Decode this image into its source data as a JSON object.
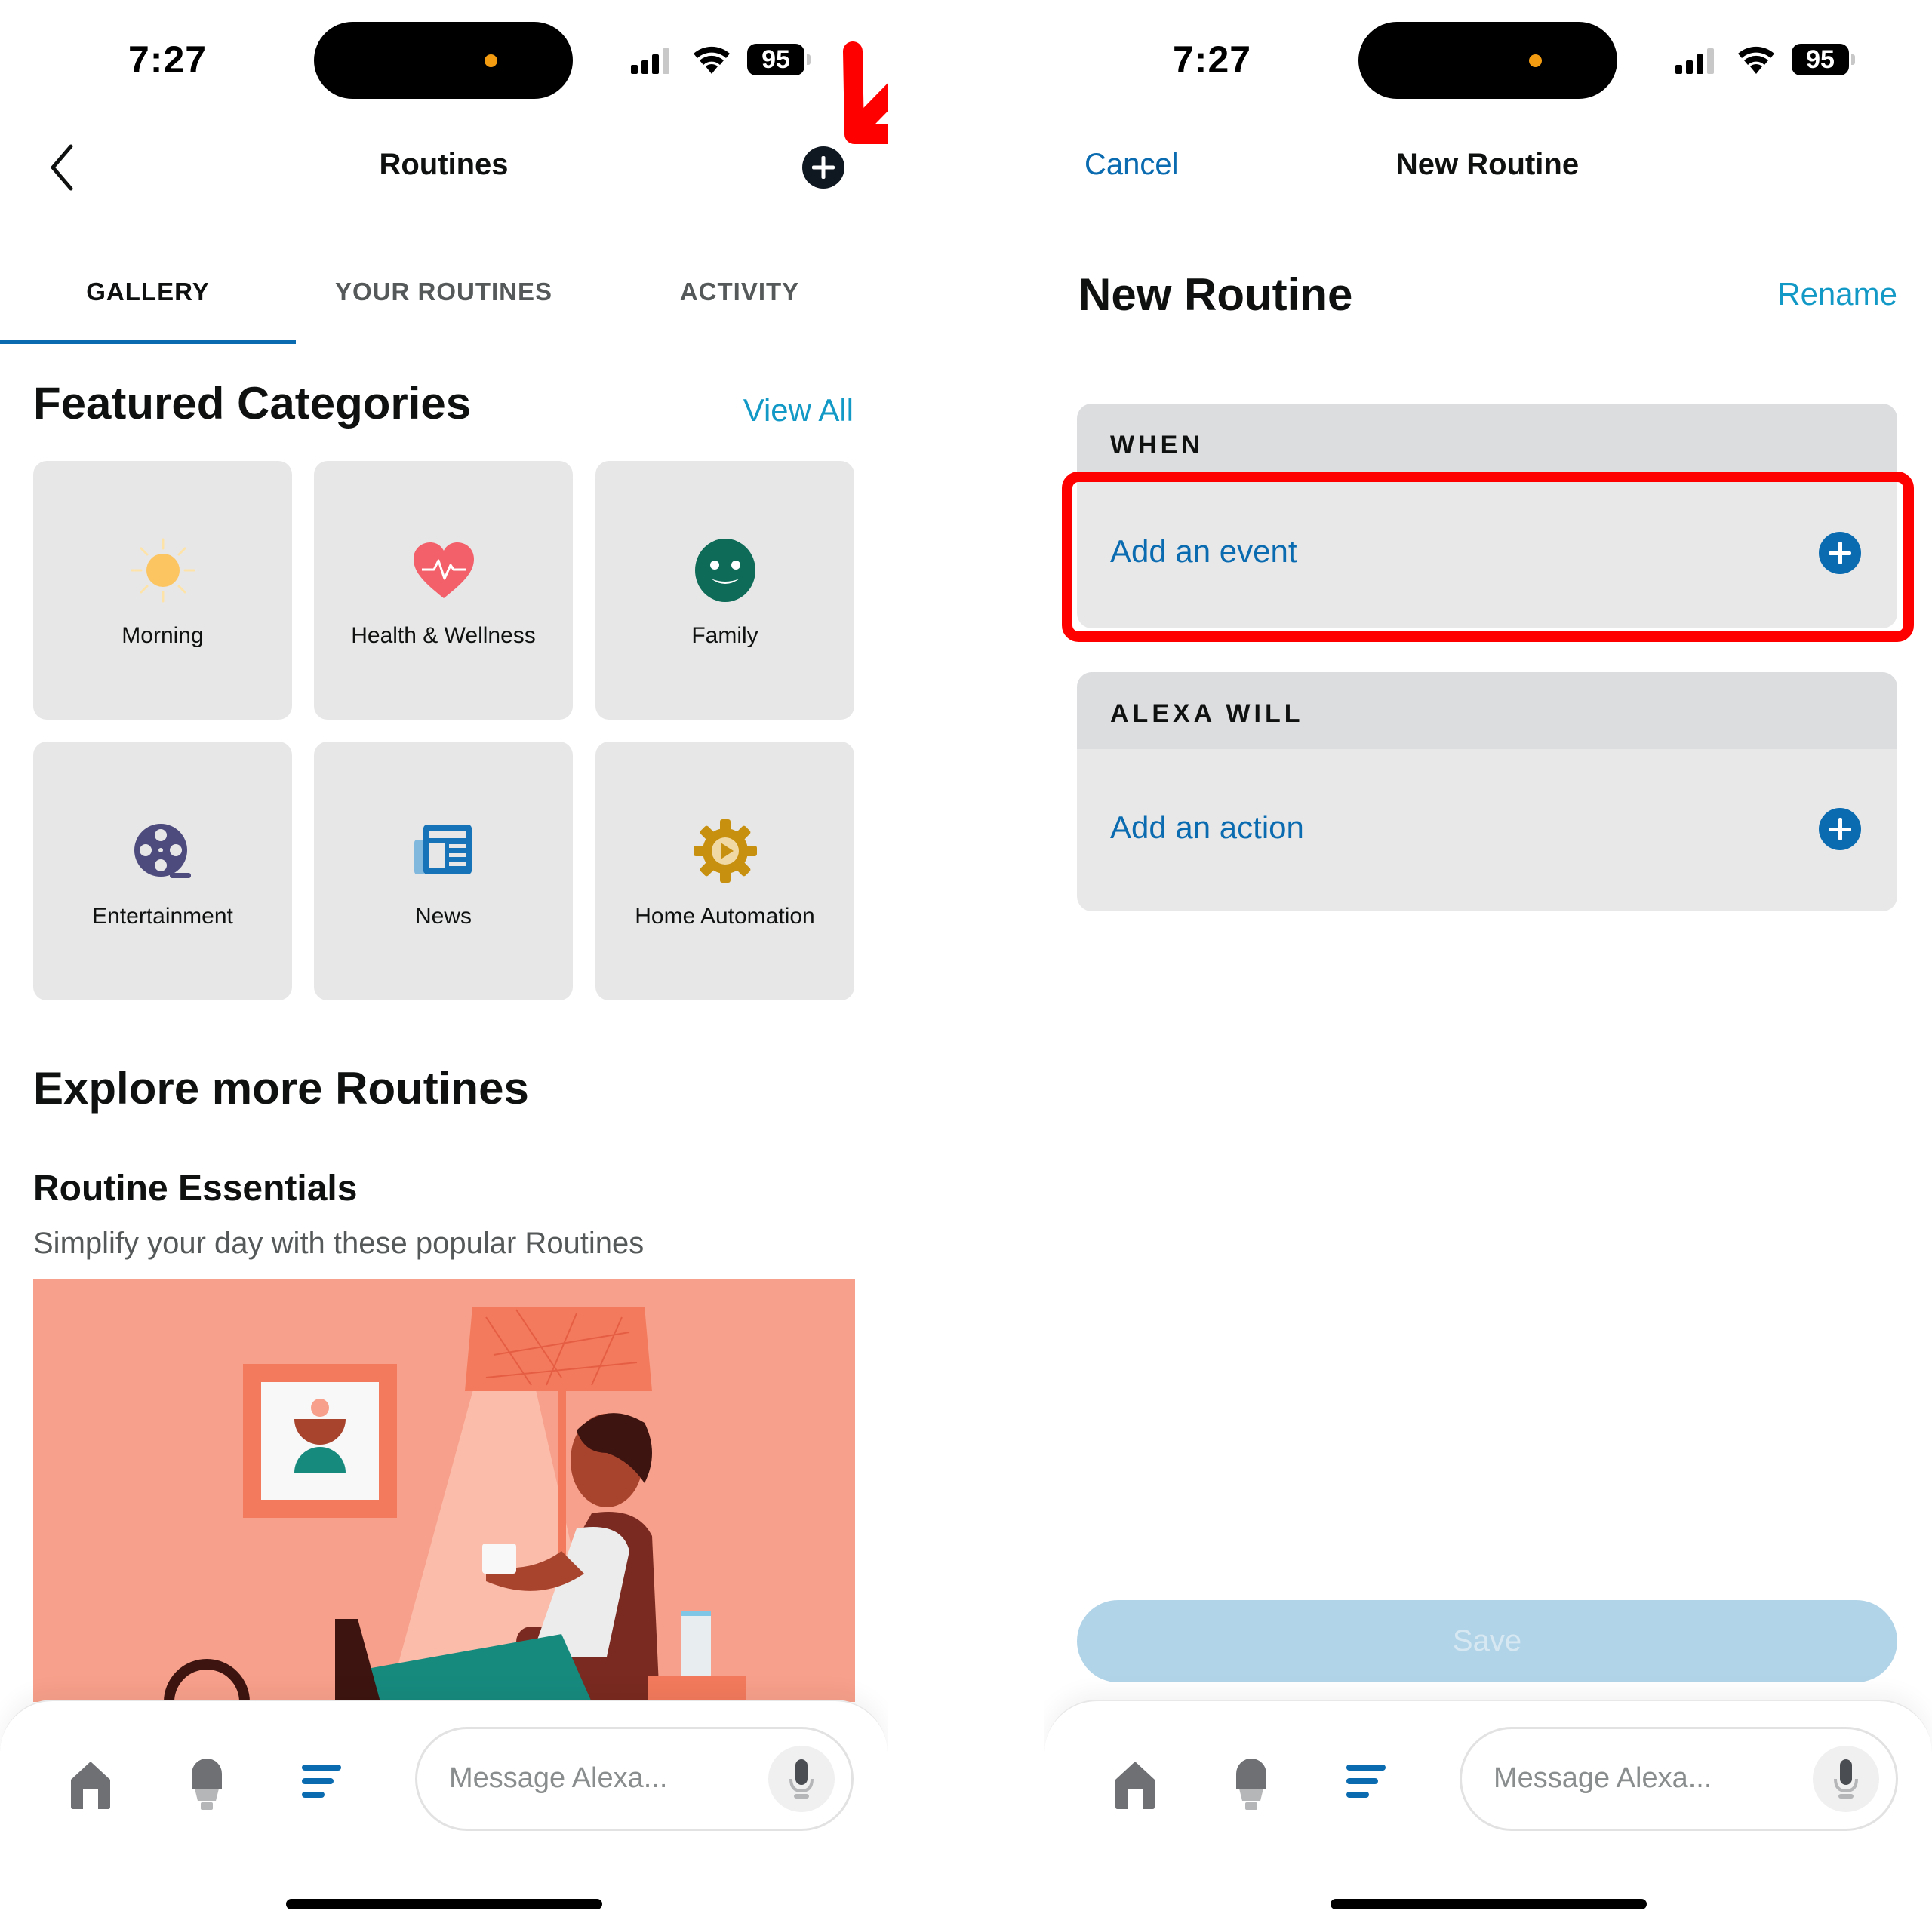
{
  "left_screen": {
    "status_bar": {
      "time": "7:27",
      "battery": "95"
    },
    "nav": {
      "title": "Routines",
      "back_icon": "chevron-left-icon",
      "add_icon": "plus-circle-icon"
    },
    "tabs": [
      {
        "label": "GALLERY",
        "active": true
      },
      {
        "label": "YOUR ROUTINES",
        "active": false
      },
      {
        "label": "ACTIVITY",
        "active": false
      }
    ],
    "featured": {
      "title": "Featured Categories",
      "view_all": "View All",
      "categories": [
        {
          "label": "Morning",
          "icon": "sun-icon"
        },
        {
          "label": "Health & Wellness",
          "icon": "heart-pulse-icon"
        },
        {
          "label": "Family",
          "icon": "smiley-icon"
        },
        {
          "label": "Entertainment",
          "icon": "film-reel-icon"
        },
        {
          "label": "News",
          "icon": "newspaper-icon"
        },
        {
          "label": "Home Automation",
          "icon": "gear-play-icon"
        }
      ]
    },
    "explore": {
      "title": "Explore more Routines",
      "subsection_title": "Routine Essentials",
      "subsection_subtitle": "Simplify your day with these popular Routines"
    },
    "bottom_bar": {
      "message_placeholder": "Message Alexa..."
    }
  },
  "right_screen": {
    "status_bar": {
      "time": "7:27",
      "battery": "95"
    },
    "nav": {
      "cancel": "Cancel",
      "title": "New Routine"
    },
    "heading": "New Routine",
    "rename": "Rename",
    "when": {
      "header": "WHEN",
      "row_label": "Add an event"
    },
    "alexa_will": {
      "header": "ALEXA WILL",
      "row_label": "Add an action"
    },
    "save": "Save",
    "bottom_bar": {
      "message_placeholder": "Message Alexa..."
    }
  },
  "colors": {
    "accent_blue": "#0a6bb0",
    "link_teal": "#1399c6",
    "annotation_red": "#ff0000",
    "card_gray": "#e7e7e7"
  }
}
